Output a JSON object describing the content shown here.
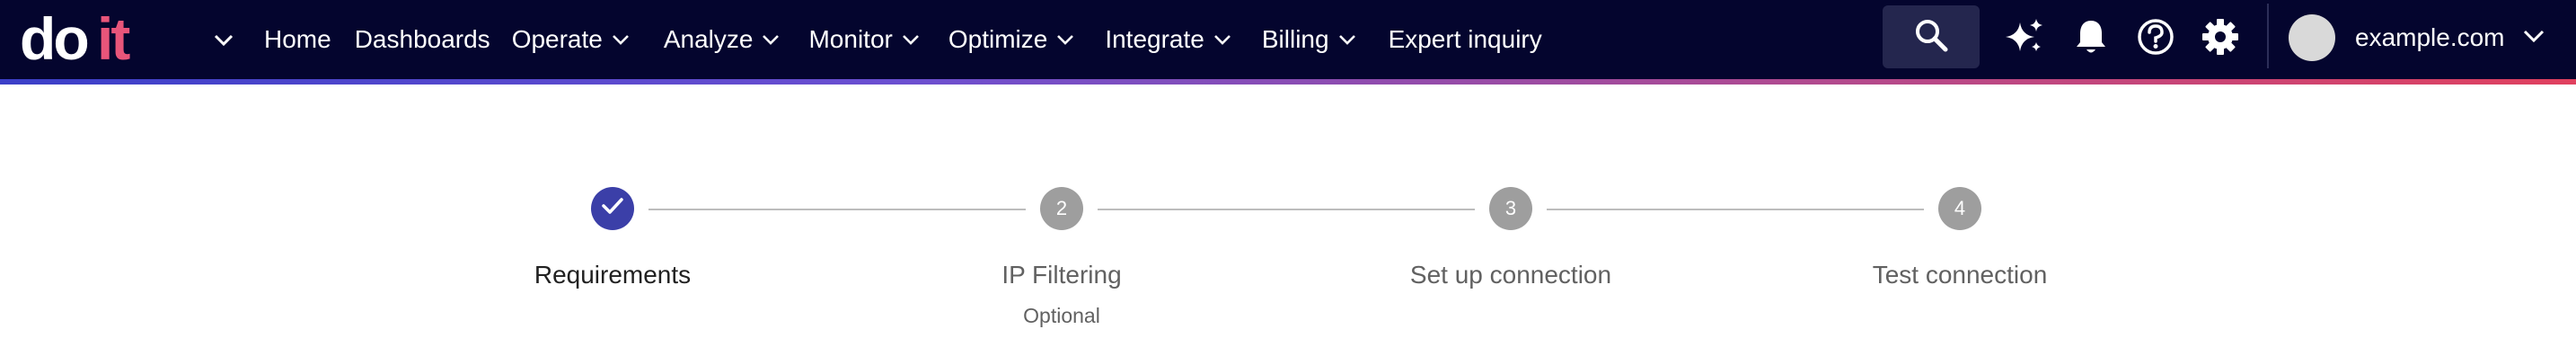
{
  "brand": {
    "logo_text": "doit"
  },
  "nav": {
    "home": "Home",
    "dashboards": "Dashboards",
    "operate": "Operate",
    "analyze": "Analyze",
    "monitor": "Monitor",
    "optimize": "Optimize",
    "integrate": "Integrate",
    "billing": "Billing",
    "expert_inquiry": "Expert inquiry"
  },
  "toolbar_icons": [
    "search-icon",
    "sparkle-icon",
    "bell-icon",
    "help-icon",
    "gear-icon"
  ],
  "account": {
    "name": "example.com"
  },
  "colors": {
    "topbar_bg": "#04052e",
    "accent": "#3b3fa8",
    "gradient_start": "#3b3fc8",
    "gradient_end": "#e0405e",
    "step_inactive": "#9e9e9e"
  },
  "stepper": {
    "steps": [
      {
        "label": "Requirements",
        "state": "completed",
        "number": "1",
        "subtitle": ""
      },
      {
        "label": "IP Filtering",
        "state": "pending",
        "number": "2",
        "subtitle": "Optional"
      },
      {
        "label": "Set up connection",
        "state": "pending",
        "number": "3",
        "subtitle": ""
      },
      {
        "label": "Test connection",
        "state": "pending",
        "number": "4",
        "subtitle": ""
      }
    ]
  }
}
